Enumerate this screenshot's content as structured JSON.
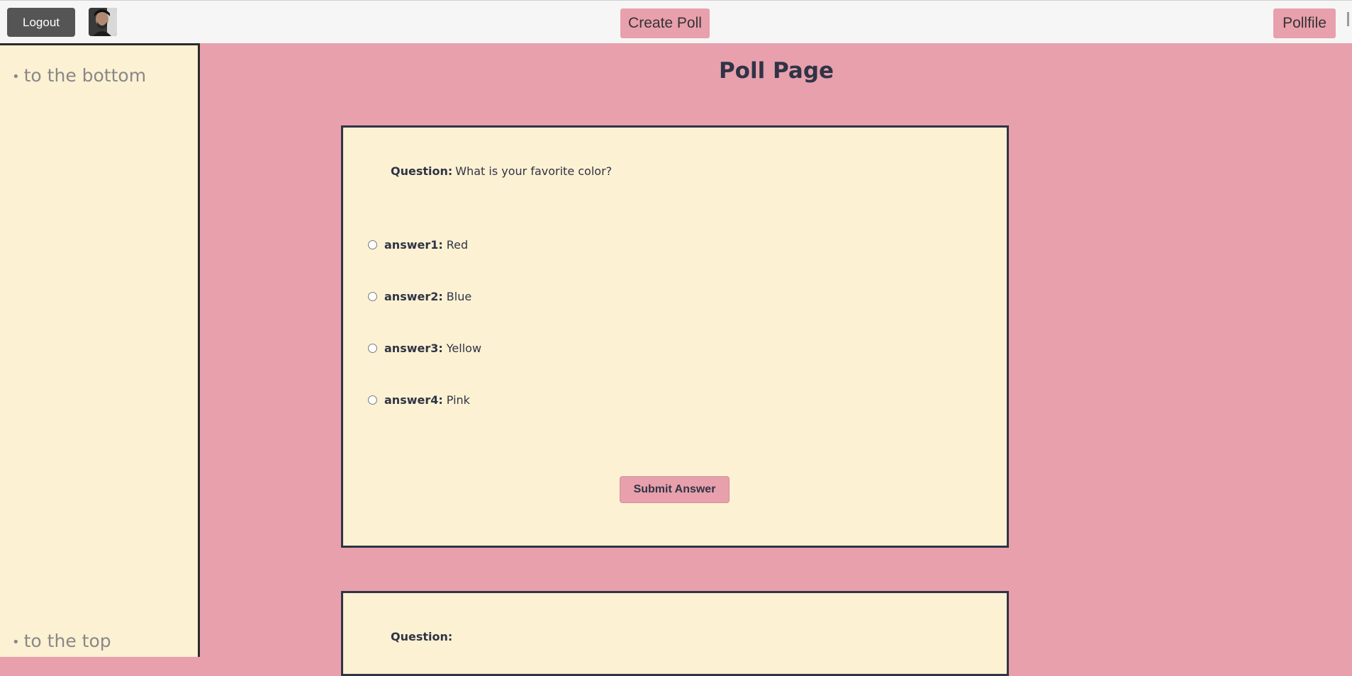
{
  "topbar": {
    "logout_label": "Logout",
    "create_label": "Create Poll",
    "pollfile_label": "Pollfile"
  },
  "sidebar": {
    "bottom_link": "to the bottom",
    "top_link": "to the top",
    "bullet": "•"
  },
  "page": {
    "title": "Poll Page"
  },
  "polls": [
    {
      "question_label": "Question:",
      "question_text": "What is your favorite color?",
      "answers": [
        {
          "label": "answer1:",
          "text": "Red"
        },
        {
          "label": "answer2:",
          "text": "Blue"
        },
        {
          "label": "answer3:",
          "text": "Yellow"
        },
        {
          "label": "answer4:",
          "text": "Pink"
        }
      ],
      "submit_label": "Submit Answer"
    },
    {
      "question_label": "Question:",
      "question_text": ""
    }
  ],
  "colors": {
    "page_bg": "#e8a0ac",
    "card_bg": "#fdf1d3",
    "text": "#2f3445",
    "logout_bg": "#555555"
  }
}
